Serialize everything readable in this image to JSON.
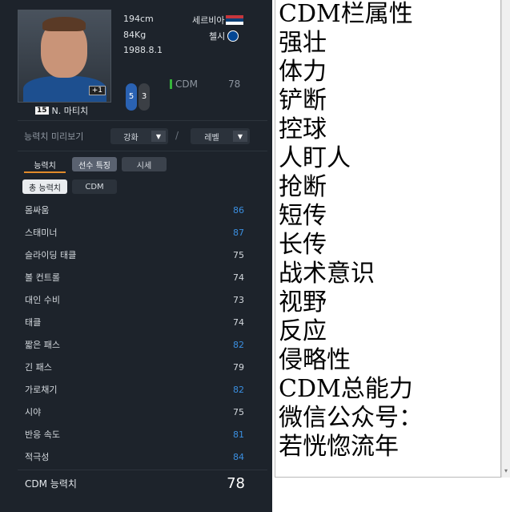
{
  "player": {
    "height": "194cm",
    "weight": "84Kg",
    "birth": "1988.8.1",
    "nation": "세르비아",
    "club": "첼시",
    "jersey": "15",
    "name": "N. 마티치",
    "photo_tag": "+1",
    "foot_left": "5",
    "foot_right": "3",
    "position": "CDM",
    "position_ovr": "78",
    "colors": {
      "panel_bg": "#1d232b",
      "highlight_value": "#3b8fe0",
      "position_bar": "#35b33a",
      "tab_underline": "#e08a2a"
    }
  },
  "controls": {
    "preview_label": "능력치 미리보기",
    "enhance": "강화",
    "level": "레벨",
    "slash": "/"
  },
  "tabs": [
    "능력치",
    "선수 특징",
    "시세"
  ],
  "subtabs": [
    "총 능력치",
    "CDM"
  ],
  "stats": [
    {
      "label": "몸싸움",
      "value": "86",
      "hi": true
    },
    {
      "label": "스태미너",
      "value": "87",
      "hi": true
    },
    {
      "label": "슬라이딩 태클",
      "value": "75",
      "hi": false
    },
    {
      "label": "볼 컨트롤",
      "value": "74",
      "hi": false
    },
    {
      "label": "대인 수비",
      "value": "73",
      "hi": false
    },
    {
      "label": "태클",
      "value": "74",
      "hi": false
    },
    {
      "label": "짧은 패스",
      "value": "82",
      "hi": true
    },
    {
      "label": "긴 패스",
      "value": "79",
      "hi": false
    },
    {
      "label": "가로채기",
      "value": "82",
      "hi": true
    },
    {
      "label": "시야",
      "value": "75",
      "hi": false
    },
    {
      "label": "반응 속도",
      "value": "81",
      "hi": true
    },
    {
      "label": "적극성",
      "value": "84",
      "hi": true
    }
  ],
  "total": {
    "label": "CDM 능력치",
    "value": "78"
  },
  "text_pane": {
    "lines": [
      "CDM栏属性",
      "强壮",
      "体力",
      "铲断",
      "控球",
      "人盯人",
      "抢断",
      "短传",
      "长传",
      "战术意识",
      "视野",
      "反应",
      "侵略性",
      "CDM总能力",
      "微信公众号：",
      "若恍惚流年"
    ]
  }
}
